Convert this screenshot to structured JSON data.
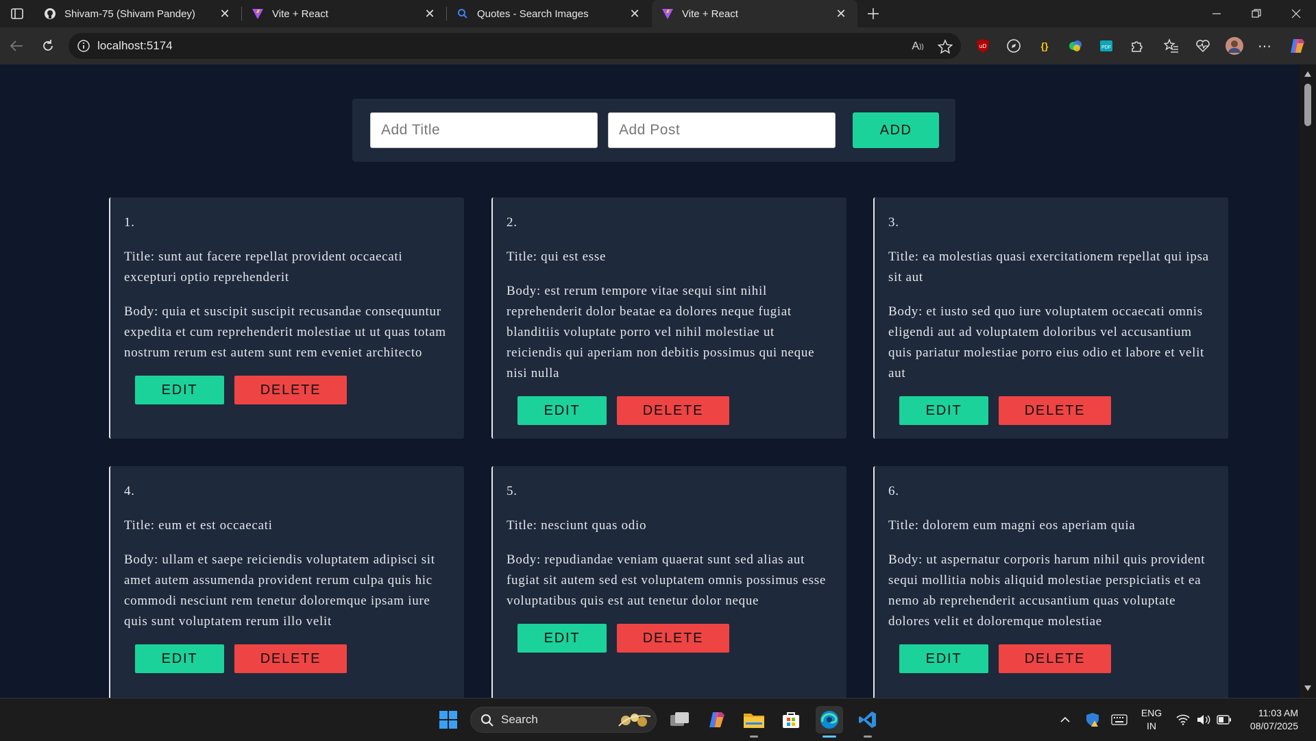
{
  "browser": {
    "tabs": [
      {
        "title": "Shivam-75 (Shivam Pandey)",
        "favicon": "github-icon",
        "active": false
      },
      {
        "title": "Vite + React",
        "favicon": "vite-icon",
        "active": false
      },
      {
        "title": "Quotes - Search Images",
        "favicon": "search-icon",
        "active": false
      },
      {
        "title": "Vite + React",
        "favicon": "vite-icon",
        "active": true
      }
    ],
    "url": "localhost:5174"
  },
  "form": {
    "title_placeholder": "Add Title",
    "post_placeholder": "Add Post",
    "add_label": "ADD"
  },
  "posts": [
    {
      "number": "1.",
      "title": "Title: sunt aut facere repellat provident occaecati excepturi optio reprehenderit",
      "body": "Body: quia et suscipit suscipit recusandae consequuntur expedita et cum reprehenderit molestiae ut ut quas totam nostrum rerum est autem sunt rem eveniet architecto",
      "edit": "EDIT",
      "delete": "DELETE"
    },
    {
      "number": "2.",
      "title": "Title: qui est esse",
      "body": "Body: est rerum tempore vitae sequi sint nihil reprehenderit dolor beatae ea dolores neque fugiat blanditiis voluptate porro vel nihil molestiae ut reiciendis qui aperiam non debitis possimus qui neque nisi nulla",
      "edit": "EDIT",
      "delete": "DELETE"
    },
    {
      "number": "3.",
      "title": "Title: ea molestias quasi exercitationem repellat qui ipsa sit aut",
      "body": "Body: et iusto sed quo iure voluptatem occaecati omnis eligendi aut ad voluptatem doloribus vel accusantium quis pariatur molestiae porro eius odio et labore et velit aut",
      "edit": "EDIT",
      "delete": "DELETE"
    },
    {
      "number": "4.",
      "title": "Title: eum et est occaecati",
      "body": "Body: ullam et saepe reiciendis voluptatem adipisci sit amet autem assumenda provident rerum culpa quis hic commodi nesciunt rem tenetur doloremque ipsam iure quis sunt voluptatem rerum illo velit",
      "edit": "EDIT",
      "delete": "DELETE"
    },
    {
      "number": "5.",
      "title": "Title: nesciunt quas odio",
      "body": "Body: repudiandae veniam quaerat sunt sed alias aut fugiat sit autem sed est voluptatem omnis possimus esse voluptatibus quis est aut tenetur dolor neque",
      "edit": "EDIT",
      "delete": "DELETE"
    },
    {
      "number": "6.",
      "title": "Title: dolorem eum magni eos aperiam quia",
      "body": "Body: ut aspernatur corporis harum nihil quis provident sequi mollitia nobis aliquid molestiae perspiciatis et ea nemo ab reprehenderit accusantium quas voluptate dolores velit et doloremque molestiae",
      "edit": "EDIT",
      "delete": "DELETE"
    }
  ],
  "taskbar": {
    "search_label": "Search",
    "language": "ENG",
    "region": "IN",
    "time": "11:03 AM",
    "date": "08/07/2025"
  },
  "colors": {
    "page_bg": "#0f172a",
    "card_bg": "#1e293b",
    "edit_green": "#1bd39a",
    "delete_red": "#ef4444"
  }
}
